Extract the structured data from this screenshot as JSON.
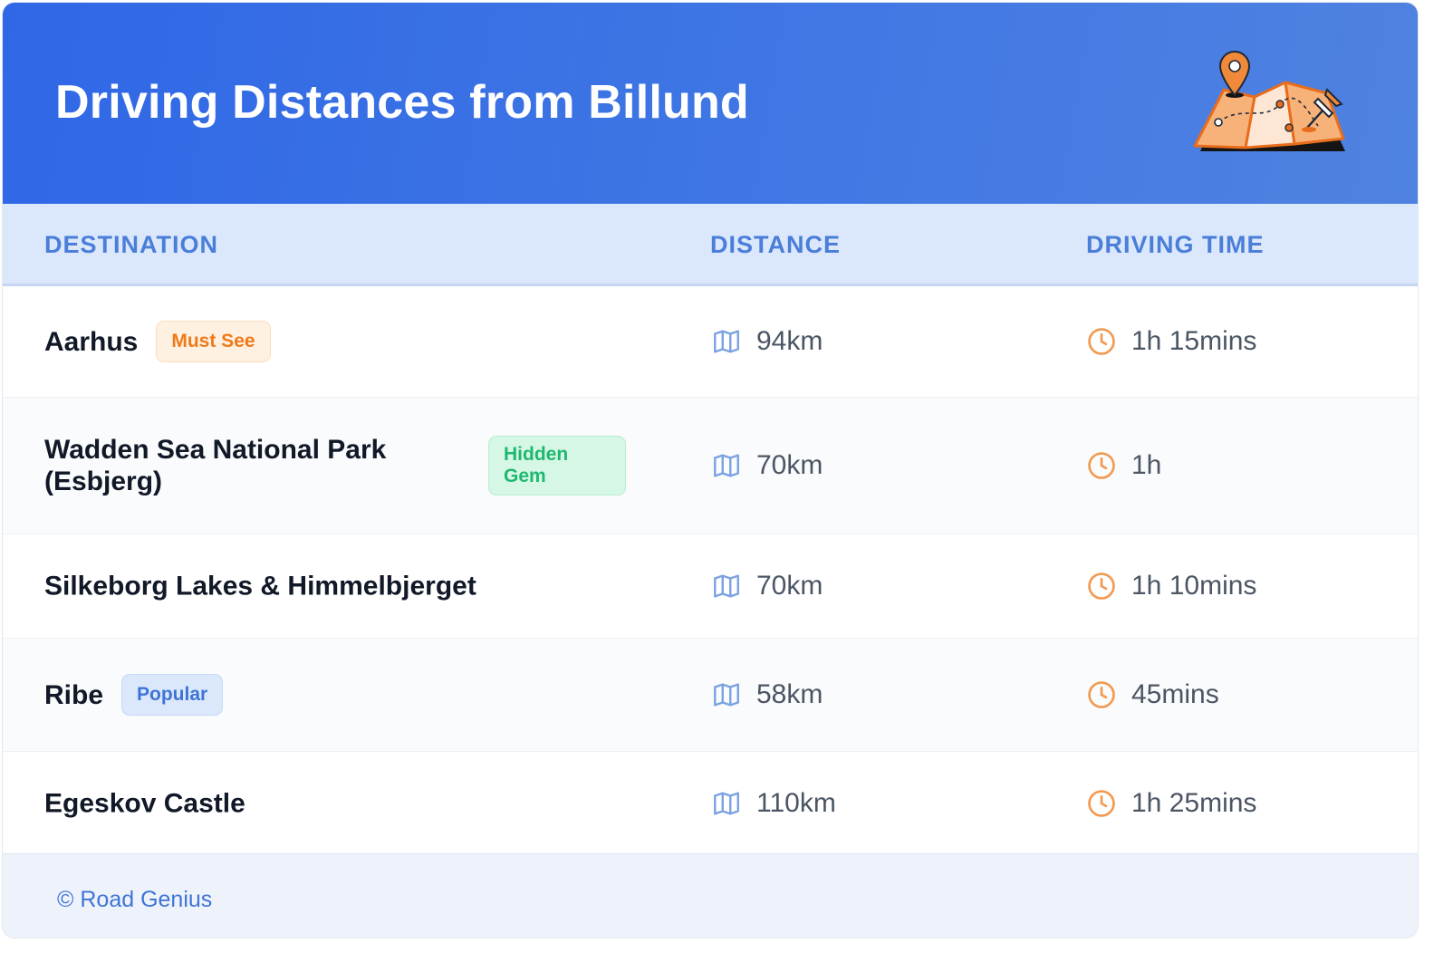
{
  "header": {
    "title": "Driving Distances from Billund"
  },
  "table": {
    "columns": {
      "destination": "DESTINATION",
      "distance": "DISTANCE",
      "driving_time": "DRIVING TIME"
    },
    "rows": [
      {
        "destination": "Aarhus",
        "badge": "Must See",
        "badge_color": "orange",
        "distance": "94km",
        "time": "1h 15mins"
      },
      {
        "destination": "Wadden Sea National Park (Esbjerg)",
        "badge": "Hidden Gem",
        "badge_color": "green",
        "distance": "70km",
        "time": "1h"
      },
      {
        "destination": "Silkeborg Lakes & Himmelbjerget",
        "badge": "",
        "distance": "70km",
        "time": "1h 10mins"
      },
      {
        "destination": "Ribe",
        "badge": "Popular",
        "badge_color": "blue",
        "distance": "58km",
        "time": "45mins"
      },
      {
        "destination": "Egeskov Castle",
        "badge": "",
        "distance": "110km",
        "time": "1h 25mins"
      }
    ]
  },
  "footer": {
    "credit": "© Road Genius"
  },
  "icons": {
    "header_illustration": "map-pin-illustration",
    "distance": "map-icon",
    "time": "clock-icon"
  },
  "colors": {
    "header_gradient_start": "#2f67e6",
    "header_gradient_end": "#4f82e0",
    "accent_blue": "#4a7ed8",
    "icon_orange": "#f29a52",
    "icon_blue": "#7aa2e3"
  }
}
